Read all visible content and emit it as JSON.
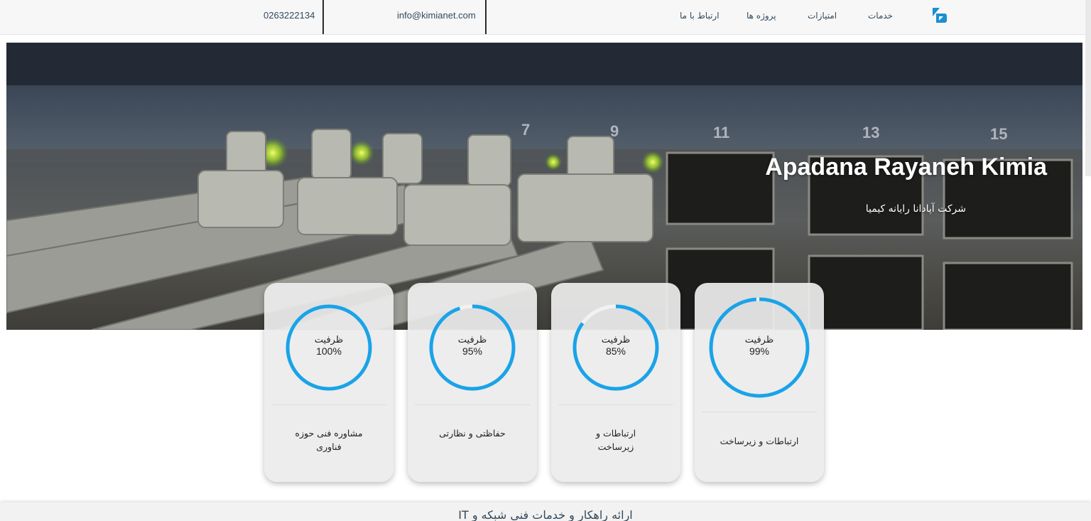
{
  "header": {
    "phone": "0263222134",
    "email": "info@kimianet.com",
    "nav": [
      "خدمات",
      "امتیازات",
      "پروژه ها",
      "ارتباط با ما"
    ]
  },
  "hero": {
    "title": "Apadana Rayaneh Kimia",
    "subtitle": "شرکت آپادانا رایانه کیمیا"
  },
  "cards": [
    {
      "label": "ظرفیت",
      "value": "100%",
      "percent": 100,
      "title": "مشاوره فنی حوزه فناوری"
    },
    {
      "label": "ظرفیت",
      "value": "95%",
      "percent": 95,
      "title": "حفاظتی و نظارتی"
    },
    {
      "label": "ظرفیت",
      "value": "85%",
      "percent": 85,
      "title": "ارتباطات و زیرساخت"
    },
    {
      "label": "ظرفیت",
      "value": "99%",
      "percent": 99,
      "title": "ارتباطات و زیرساخت"
    }
  ],
  "bottom": {
    "text": "ارائه راهکار و خدمات فنی شبکه و IT"
  },
  "colors": {
    "accent": "#1aa3e8",
    "track": "#f2f2f2",
    "text": "#33495c"
  }
}
